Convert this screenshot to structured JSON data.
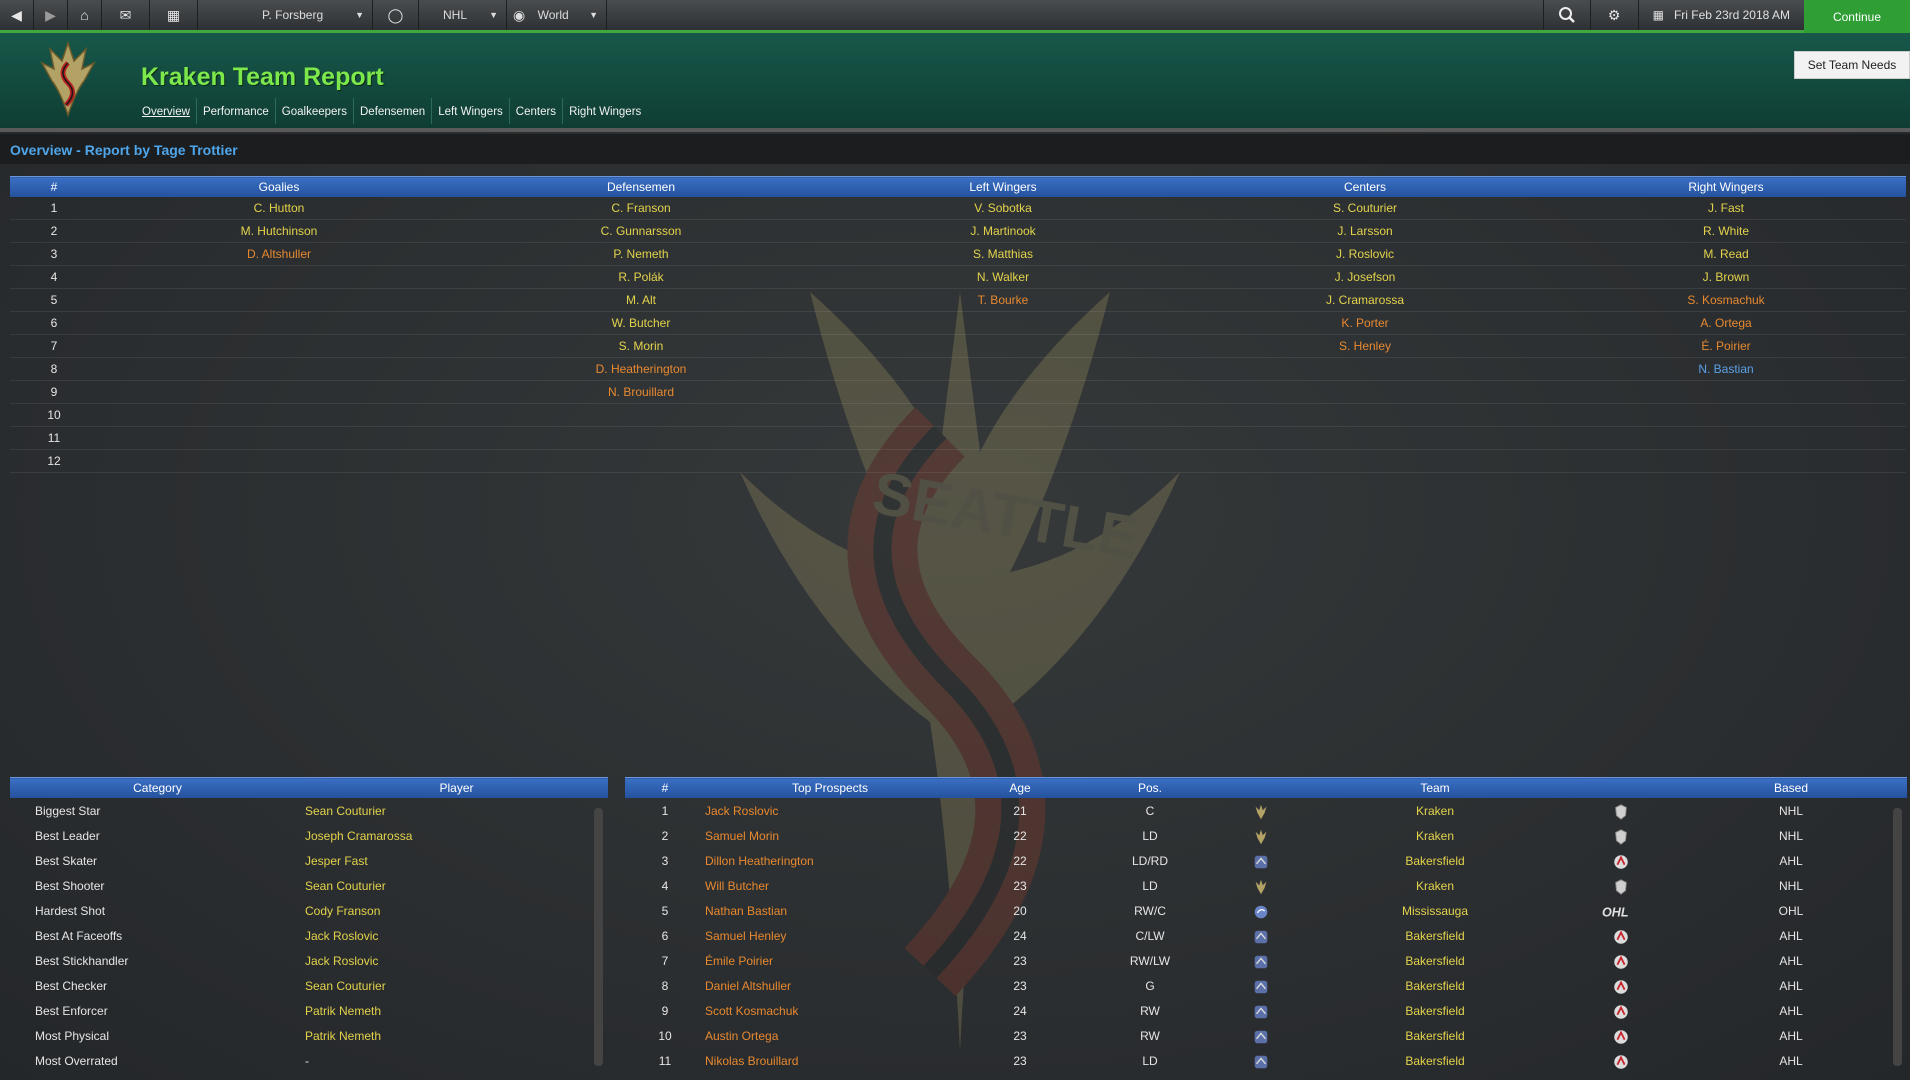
{
  "topbar": {
    "manager": "P. Forsberg",
    "league": "NHL",
    "region": "World",
    "date": "Fri Feb 23rd 2018 AM",
    "continue": "Continue"
  },
  "header": {
    "title": "Kraken Team Report",
    "set_needs": "Set Team Needs",
    "tabs": [
      "Overview",
      "Performance",
      "Goalkeepers",
      "Defensemen",
      "Left Wingers",
      "Centers",
      "Right Wingers"
    ]
  },
  "subheader": "Overview - Report by Tage Trottier",
  "watermark": {
    "text": "SEATTLE"
  },
  "depth": {
    "headers": [
      "#",
      "Goalies",
      "Defensemen",
      "Left Wingers",
      "Centers",
      "Right Wingers"
    ],
    "rows": [
      [
        "1",
        "C. Hutton",
        "C. Franson",
        "V. Sobotka",
        "S. Couturier",
        "J. Fast"
      ],
      [
        "2",
        "M. Hutchinson",
        "C. Gunnarsson",
        "J. Martinook",
        "J. Larsson",
        "R. White"
      ],
      [
        "3",
        "D. Altshuller",
        "P. Nemeth",
        "S. Matthias",
        "J. Roslovic",
        "M. Read"
      ],
      [
        "4",
        "",
        "R. Polák",
        "N. Walker",
        "J. Josefson",
        "J. Brown"
      ],
      [
        "5",
        "",
        "M. Alt",
        "T. Bourke",
        "J. Cramarossa",
        "S. Kosmachuk"
      ],
      [
        "6",
        "",
        "W. Butcher",
        "",
        "K. Porter",
        "A. Ortega"
      ],
      [
        "7",
        "",
        "S. Morin",
        "",
        "S. Henley",
        "É. Poirier"
      ],
      [
        "8",
        "",
        "D. Heatherington",
        "",
        "",
        "N. Bastian"
      ],
      [
        "9",
        "",
        "N. Brouillard",
        "",
        "",
        ""
      ],
      [
        "10",
        "",
        "",
        "",
        "",
        ""
      ],
      [
        "11",
        "",
        "",
        "",
        "",
        ""
      ],
      [
        "12",
        "",
        "",
        "",
        "",
        ""
      ]
    ],
    "colors": [
      [
        "w",
        "y",
        "y",
        "y",
        "y",
        "y"
      ],
      [
        "w",
        "y",
        "y",
        "y",
        "y",
        "y"
      ],
      [
        "w",
        "o",
        "y",
        "y",
        "y",
        "y"
      ],
      [
        "w",
        "y",
        "y",
        "y",
        "y",
        "y"
      ],
      [
        "w",
        "y",
        "y",
        "o",
        "y",
        "o"
      ],
      [
        "w",
        "y",
        "y",
        "y",
        "o",
        "o"
      ],
      [
        "w",
        "y",
        "y",
        "y",
        "o",
        "o"
      ],
      [
        "w",
        "y",
        "o",
        "y",
        "y",
        "b"
      ],
      [
        "w",
        "y",
        "o",
        "y",
        "y",
        "y"
      ],
      [
        "w",
        "y",
        "y",
        "y",
        "y",
        "y"
      ],
      [
        "w",
        "y",
        "y",
        "y",
        "y",
        "y"
      ],
      [
        "w",
        "y",
        "y",
        "y",
        "y",
        "y"
      ]
    ]
  },
  "awards": {
    "headers": [
      "Category",
      "Player"
    ],
    "rows": [
      [
        "Biggest Star",
        "Sean Couturier"
      ],
      [
        "Best Leader",
        "Joseph Cramarossa"
      ],
      [
        "Best Skater",
        "Jesper Fast"
      ],
      [
        "Best Shooter",
        "Sean Couturier"
      ],
      [
        "Hardest Shot",
        "Cody Franson"
      ],
      [
        "Best At Faceoffs",
        "Jack Roslovic"
      ],
      [
        "Best Stickhandler",
        "Jack Roslovic"
      ],
      [
        "Best Checker",
        "Sean Couturier"
      ],
      [
        "Best Enforcer",
        "Patrik Nemeth"
      ],
      [
        "Most Physical",
        "Patrik Nemeth"
      ],
      [
        "Most Overrated",
        "-"
      ]
    ]
  },
  "prospects": {
    "headers": [
      "#",
      "Top Prospects",
      "Age",
      "Pos.",
      "",
      "Team",
      "",
      "Based"
    ],
    "rows": [
      {
        "n": "1",
        "name": "Jack Roslovic",
        "age": "21",
        "pos": "C",
        "team": "Kraken",
        "based": "NHL",
        "logo": "kraken-logo-icon",
        "league_logo": "nhl-logo-icon"
      },
      {
        "n": "2",
        "name": "Samuel Morin",
        "age": "22",
        "pos": "LD",
        "team": "Kraken",
        "based": "NHL",
        "logo": "kraken-logo-icon",
        "league_logo": "nhl-logo-icon"
      },
      {
        "n": "3",
        "name": "Dillon Heatherington",
        "age": "22",
        "pos": "LD/RD",
        "team": "Bakersfield",
        "based": "AHL",
        "logo": "condors-logo-icon",
        "league_logo": "ahl-logo-icon"
      },
      {
        "n": "4",
        "name": "Will Butcher",
        "age": "23",
        "pos": "LD",
        "team": "Kraken",
        "based": "NHL",
        "logo": "kraken-logo-icon",
        "league_logo": "nhl-logo-icon"
      },
      {
        "n": "5",
        "name": "Nathan Bastian",
        "age": "20",
        "pos": "RW/C",
        "team": "Mississauga",
        "based": "OHL",
        "logo": "steelheads-logo-icon",
        "league_logo": "ohl-logo-icon"
      },
      {
        "n": "6",
        "name": "Samuel Henley",
        "age": "24",
        "pos": "C/LW",
        "team": "Bakersfield",
        "based": "AHL",
        "logo": "condors-logo-icon",
        "league_logo": "ahl-logo-icon"
      },
      {
        "n": "7",
        "name": "Émile Poirier",
        "age": "23",
        "pos": "RW/LW",
        "team": "Bakersfield",
        "based": "AHL",
        "logo": "condors-logo-icon",
        "league_logo": "ahl-logo-icon"
      },
      {
        "n": "8",
        "name": "Daniel Altshuller",
        "age": "23",
        "pos": "G",
        "team": "Bakersfield",
        "based": "AHL",
        "logo": "condors-logo-icon",
        "league_logo": "ahl-logo-icon"
      },
      {
        "n": "9",
        "name": "Scott Kosmachuk",
        "age": "24",
        "pos": "RW",
        "team": "Bakersfield",
        "based": "AHL",
        "logo": "condors-logo-icon",
        "league_logo": "ahl-logo-icon"
      },
      {
        "n": "10",
        "name": "Austin Ortega",
        "age": "23",
        "pos": "RW",
        "team": "Bakersfield",
        "based": "AHL",
        "logo": "condors-logo-icon",
        "league_logo": "ahl-logo-icon"
      },
      {
        "n": "11",
        "name": "Nikolas Brouillard",
        "age": "23",
        "pos": "LD",
        "team": "Bakersfield",
        "based": "AHL",
        "logo": "condors-logo-icon",
        "league_logo": "ahl-logo-icon"
      }
    ]
  },
  "colors": {
    "accent_green": "#3fa93f",
    "title_green": "#7de84b",
    "header_blue": "#2a5cae",
    "link_blue": "#4fa6ea",
    "name_yellow": "#e3d34c",
    "name_orange": "#e8892f"
  }
}
